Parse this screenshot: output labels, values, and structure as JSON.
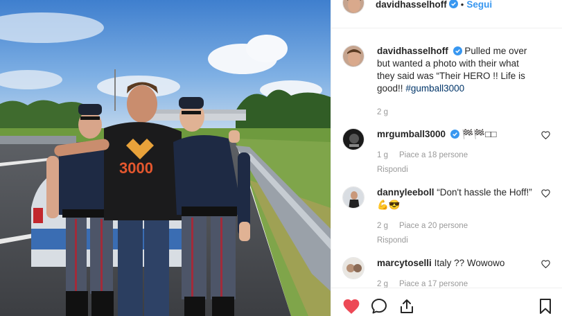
{
  "post": {
    "author": "davidhasselhoff",
    "follow_label": "Segui",
    "separator": "•"
  },
  "caption": {
    "username": "davidhasselhoff",
    "text": "Pulled me over but wanted a photo with their what they said was “Their HERO !! Life is good!!",
    "hashtag": "#gumball3000",
    "time": "2 g"
  },
  "comments": [
    {
      "username": "mrgumball3000",
      "verified": true,
      "text": "🏁🏁□□",
      "time": "1 g",
      "likes": "Piace a 18 persone",
      "reply": "Rispondi"
    },
    {
      "username": "dannyleeboll",
      "verified": false,
      "text": "“Don't hassle the Hoff!” 💪😎",
      "time": "2 g",
      "likes": "Piace a 20 persone",
      "reply": "Rispondi"
    },
    {
      "username": "marcytoselli",
      "verified": false,
      "text": "Italy ?? Wowowo",
      "time": "2 g",
      "likes": "Piace a 17 persone",
      "reply": ""
    }
  ],
  "photo": {
    "shirt_text": "3000"
  },
  "icons": [
    "verified-icon",
    "heart-filled-icon",
    "comment-icon",
    "share-icon",
    "bookmark-icon",
    "heart-outline-icon"
  ],
  "colors": {
    "accent": "#3897f0",
    "like": "#ed4956",
    "hashtag": "#003569",
    "muted": "#999999"
  }
}
